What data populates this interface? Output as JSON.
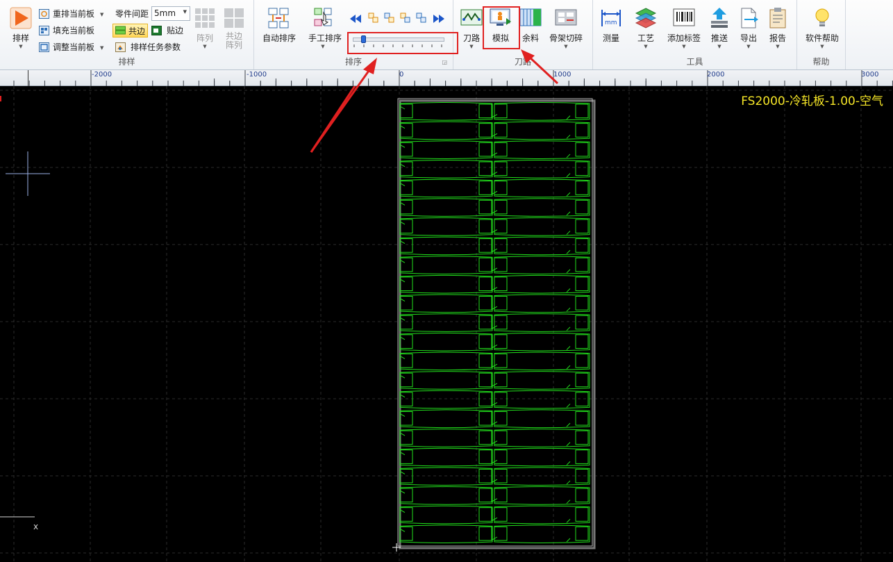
{
  "ribbon": {
    "nesting_group": {
      "label": "排样",
      "nest_button": "排样",
      "rearrange_current": "重排当前板",
      "fill_current": "填充当前板",
      "adjust_current": "调整当前板",
      "part_spacing_label": "零件间距",
      "part_spacing_value": "5mm",
      "common_edge": "共边",
      "stick_edge": "贴边",
      "nest_task_params": "排样任务参数",
      "array": "阵列",
      "common_array_line1": "共边",
      "common_array_line2": "阵列"
    },
    "sort_group": {
      "label": "排序",
      "auto_sort": "自动排序",
      "manual_sort": "手工排序",
      "slider_value_pct": 2
    },
    "path_group": {
      "label": "刀路",
      "tool_path": "刀路",
      "simulate": "模拟",
      "remnant": "余料",
      "skeleton_cut": "骨架切碎"
    },
    "tools_group": {
      "label": "工具",
      "measure": "测量",
      "process": "工艺",
      "add_label": "添加标签",
      "push": "推送",
      "export": "导出",
      "report": "报告"
    },
    "help_group": {
      "label": "帮助",
      "software_help": "软件帮助"
    }
  },
  "ruler": {
    "labels": [
      "-2000",
      "-1000",
      "0",
      "1000",
      "2000",
      "3000"
    ]
  },
  "canvas": {
    "material_label": "FS2000-冷轧板-1.00-空气",
    "axis_x_label": "x",
    "part_rows": 23
  },
  "colors": {
    "part_outline": "#22e01c",
    "sheet_border": "#b8b8b8",
    "annotation": "#e02020",
    "material_text": "#f6e627",
    "ruler_text": "#1e3a8a"
  }
}
